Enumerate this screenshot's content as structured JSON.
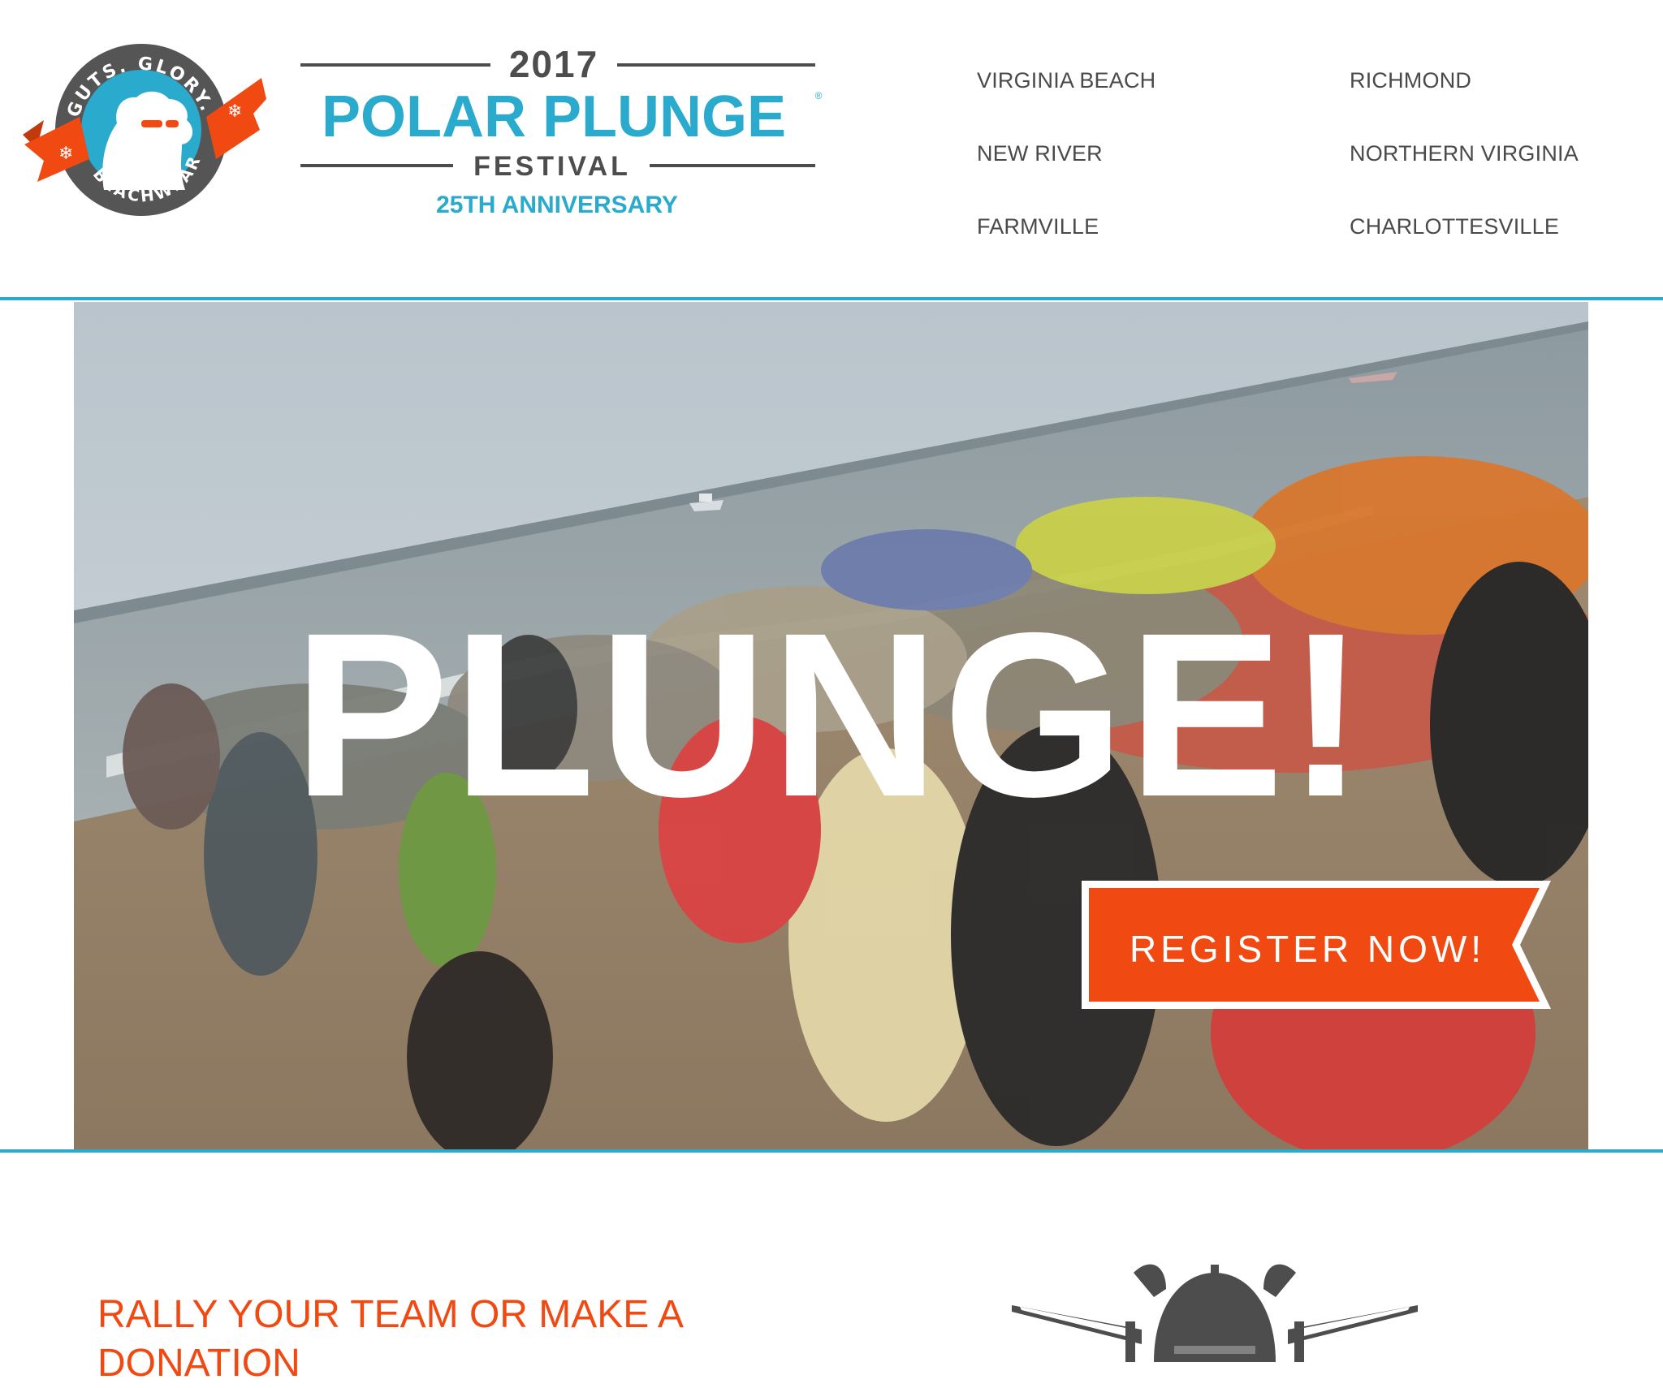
{
  "brand": {
    "badge_top": "GUTS. GLORY.",
    "badge_bottom": "BEACHWEAR.",
    "year": "2017",
    "name": "POLAR PLUNGE",
    "registered": "®",
    "festival": "FESTIVAL",
    "anniversary": "25TH ANNIVERSARY"
  },
  "nav": {
    "items": [
      {
        "label": "VIRGINIA BEACH"
      },
      {
        "label": "RICHMOND"
      },
      {
        "label": "NEW RIVER"
      },
      {
        "label": "NORTHERN VIRGINIA"
      },
      {
        "label": "FARMVILLE"
      },
      {
        "label": "CHARLOTTESVILLE"
      }
    ]
  },
  "hero": {
    "headline": "PLUNGE!",
    "cta_label": "REGISTER NOW!"
  },
  "section": {
    "heading": "RALLY YOUR TEAM OR MAKE A DONATION"
  },
  "colors": {
    "accent_teal": "#2aaacc",
    "accent_orange": "#f04a12",
    "text_gray": "#4a4a4a",
    "dark_gray": "#4d4d4d"
  },
  "icons": {
    "badge": "polar-bear-badge-icon",
    "viking": "viking-helmet-swords-icon"
  }
}
